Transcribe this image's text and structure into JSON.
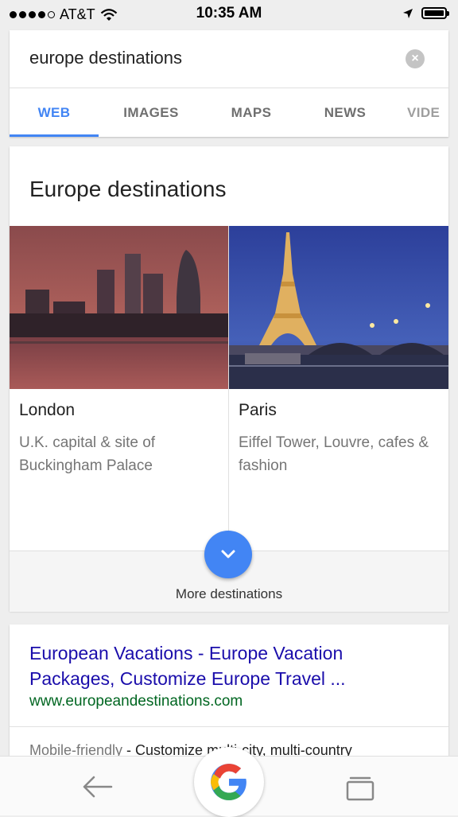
{
  "status_bar": {
    "carrier": "AT&T",
    "time": "10:35 AM",
    "signal_bars_filled": 4,
    "signal_bars_total": 5
  },
  "search": {
    "query": "europe destinations"
  },
  "tabs": [
    {
      "label": "WEB",
      "active": true
    },
    {
      "label": "IMAGES",
      "active": false
    },
    {
      "label": "MAPS",
      "active": false
    },
    {
      "label": "NEWS",
      "active": false
    },
    {
      "label": "VIDE",
      "active": false
    }
  ],
  "destinations": {
    "heading": "Europe destinations",
    "items": [
      {
        "name": "London",
        "description": "U.K. capital & site of Buckingham Palace"
      },
      {
        "name": "Paris",
        "description": "Eiffel Tower, Louvre, cafes & fashion"
      }
    ],
    "more_label": "More destinations"
  },
  "result": {
    "title": "European Vacations - Europe Vacation Packages, Customize Europe Travel ...",
    "url": "www.europeandestinations.com",
    "snippet_label": "Mobile-friendly",
    "snippet_text": " - Customize multi-city, multi-country"
  },
  "colors": {
    "accent": "#4285f4",
    "link": "#1a0dab",
    "url": "#006621"
  },
  "icons": {
    "back": "back-arrow-icon",
    "google": "google-g-icon",
    "tabs": "tabs-icon",
    "clear": "clear-icon",
    "expand": "chevron-down-icon",
    "location": "location-arrow-icon",
    "wifi": "wifi-icon",
    "battery": "battery-icon"
  }
}
